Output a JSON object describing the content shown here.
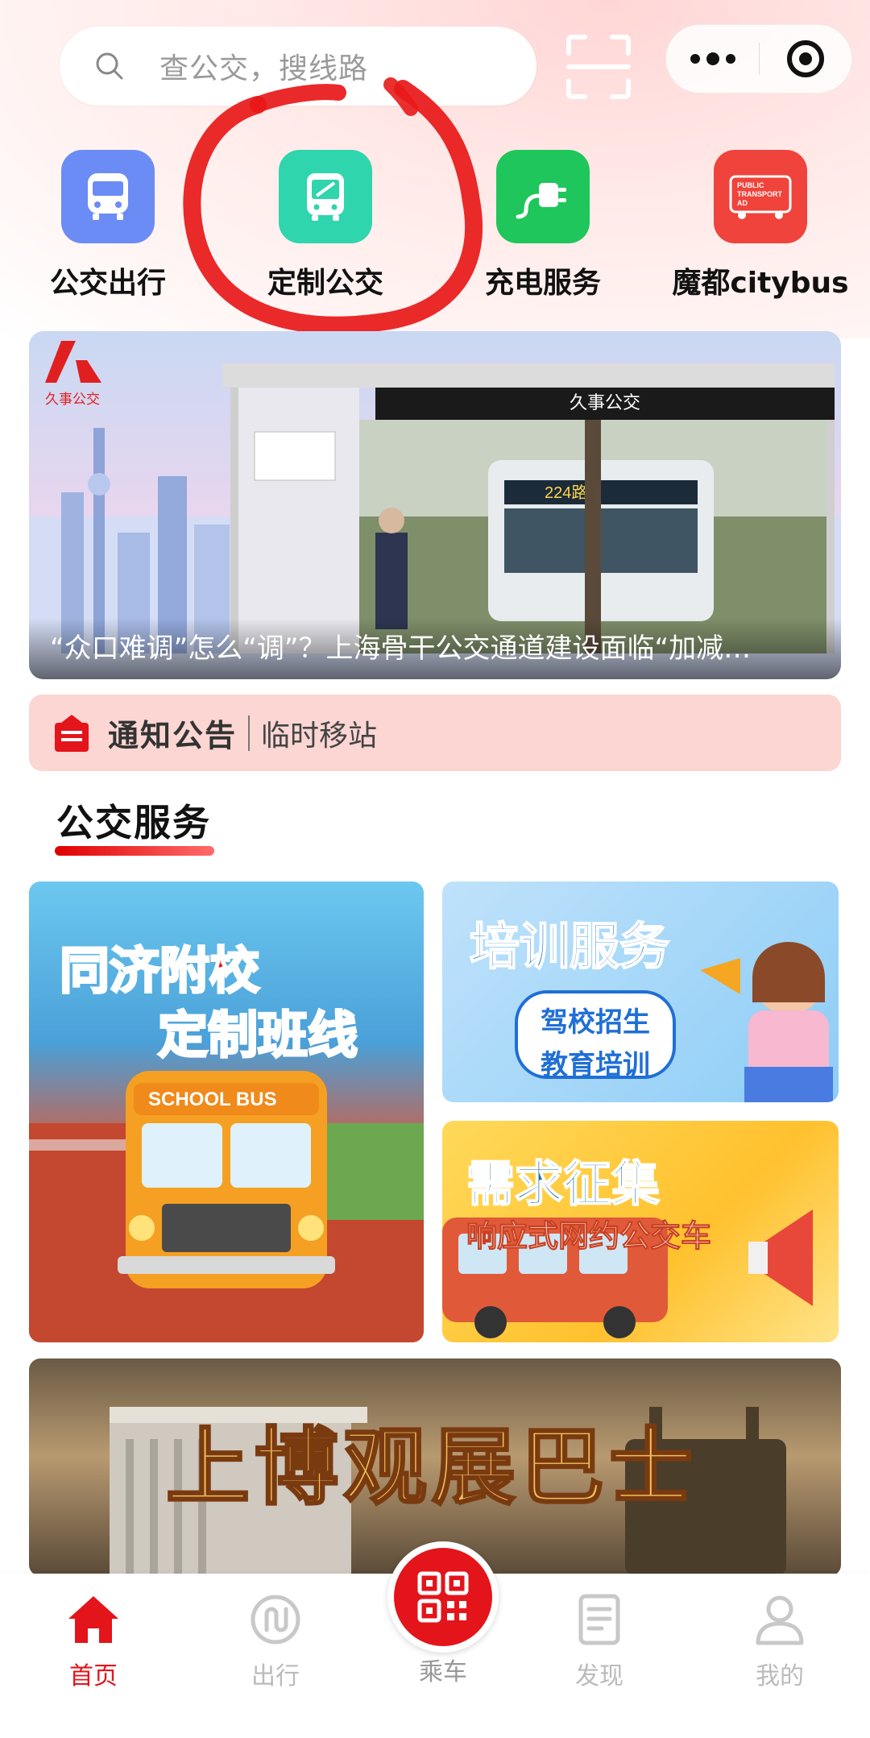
{
  "search": {
    "placeholder": "查公交，搜线路"
  },
  "quick_nav": [
    {
      "label": "公交出行",
      "icon": "bus-icon",
      "color": "#6b8cf5"
    },
    {
      "label": "定制公交",
      "icon": "custom-bus-icon",
      "color": "#2fd5ad"
    },
    {
      "label": "充电服务",
      "icon": "charging-plug-icon",
      "color": "#1fc65b"
    },
    {
      "label": "魔都citybus",
      "icon": "public-transport-ad-icon",
      "color": "#f0433b"
    }
  ],
  "banner": {
    "caption": "“众口难调”怎么“调”？上海骨干公交通道建设面临“加减…",
    "logo_text": "久事公交",
    "sign_text": "久事公交"
  },
  "notice": {
    "title": "通知公告",
    "text": "临时移站"
  },
  "section": {
    "title": "公交服务"
  },
  "cards": {
    "school": {
      "line1": "同济附校",
      "line2": "定制班线",
      "bus_sign": "SCHOOL BUS"
    },
    "training": {
      "title": "培训服务",
      "line1": "驾校招生",
      "line2": "教育培训"
    },
    "demand": {
      "title": "需求征集",
      "subtitle": "响应式网约公交车"
    },
    "museum": {
      "title": "上博观展巴士"
    }
  },
  "tabbar": {
    "home": "首页",
    "travel": "出行",
    "ride": "乘车",
    "discover": "发现",
    "mine": "我的"
  },
  "colors": {
    "accent": "#e4141b",
    "annotation": "#e81818"
  }
}
